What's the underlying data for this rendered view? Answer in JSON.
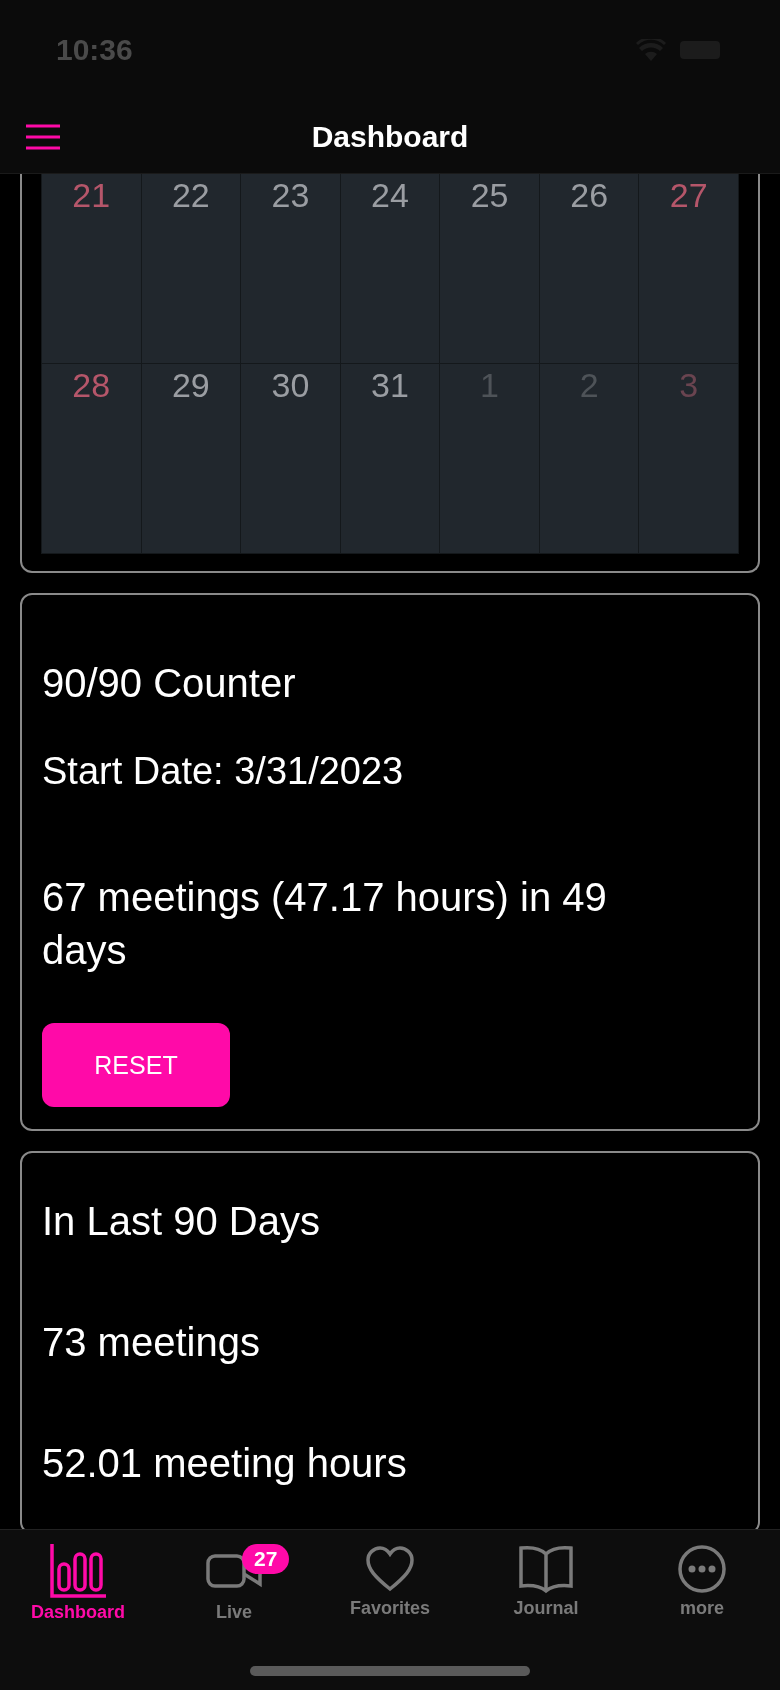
{
  "status_bar": {
    "time": "10:36"
  },
  "nav_bar": {
    "title": "Dashboard"
  },
  "calendar": {
    "weeks": [
      [
        {
          "day": "21",
          "weekend": true,
          "other_month": false
        },
        {
          "day": "22",
          "weekend": false,
          "other_month": false
        },
        {
          "day": "23",
          "weekend": false,
          "other_month": false
        },
        {
          "day": "24",
          "weekend": false,
          "other_month": false
        },
        {
          "day": "25",
          "weekend": false,
          "other_month": false
        },
        {
          "day": "26",
          "weekend": false,
          "other_month": false
        },
        {
          "day": "27",
          "weekend": true,
          "other_month": false
        }
      ],
      [
        {
          "day": "28",
          "weekend": true,
          "other_month": false
        },
        {
          "day": "29",
          "weekend": false,
          "other_month": false
        },
        {
          "day": "30",
          "weekend": false,
          "other_month": false
        },
        {
          "day": "31",
          "weekend": false,
          "other_month": false
        },
        {
          "day": "1",
          "weekend": false,
          "other_month": true
        },
        {
          "day": "2",
          "weekend": false,
          "other_month": true
        },
        {
          "day": "3",
          "weekend": true,
          "other_month": true
        }
      ]
    ]
  },
  "counter_card": {
    "title": "90/90 Counter",
    "start_date": "Start Date: 3/31/2023",
    "summary": "67 meetings (47.17 hours) in 49 days",
    "button": "RESET"
  },
  "last_90_card": {
    "title": "In Last 90 Days",
    "meetings": "73 meetings",
    "hours": "52.01 meeting hours"
  },
  "tab_bar": [
    {
      "kind": "chart",
      "label": "Dashboard",
      "selected": true
    },
    {
      "kind": "video",
      "label": "Live",
      "selected": false,
      "badge": "27"
    },
    {
      "kind": "heart",
      "label": "Favorites",
      "selected": false
    },
    {
      "kind": "book",
      "label": "Journal",
      "selected": false
    },
    {
      "kind": "more",
      "label": "more",
      "selected": false
    }
  ]
}
